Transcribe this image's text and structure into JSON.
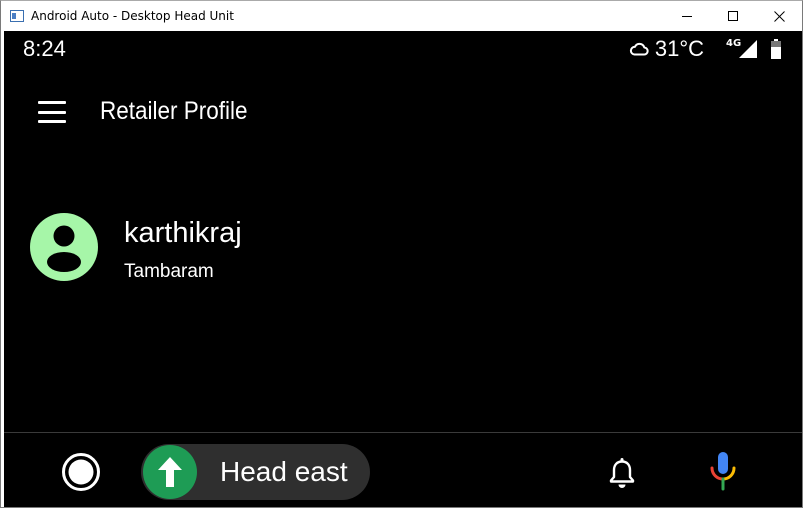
{
  "window": {
    "title": "Android Auto - Desktop Head Unit",
    "controls": [
      "minimize-icon",
      "maximize-icon",
      "close-icon"
    ]
  },
  "status_bar": {
    "time": "8:24",
    "weather_icon": "cloud-icon",
    "temperature": "31°C",
    "network": "4G",
    "signal_icon": "signal-icon",
    "battery_icon": "battery-icon"
  },
  "app_bar": {
    "menu_icon": "menu-icon",
    "title": "Retailer Profile"
  },
  "profile": {
    "avatar_icon": "person-icon",
    "name": "karthikraj",
    "location": "Tambaram"
  },
  "bottom_bar": {
    "home_icon": "home-circle-icon",
    "navigation": {
      "direction_icon": "arrow-up-icon",
      "instruction": "Head east"
    },
    "notifications_icon": "bell-icon",
    "voice_icon": "mic-icon"
  },
  "colors": {
    "screen_background": "#000000",
    "avatar_background": "#a6f6a8",
    "nav_pill": "#2f2f2f",
    "nav_arrow": "#1e9c55",
    "mic_blue": "#4285f4",
    "mic_red": "#ea4335",
    "mic_yellow": "#fbbc05",
    "mic_green": "#34a853"
  }
}
